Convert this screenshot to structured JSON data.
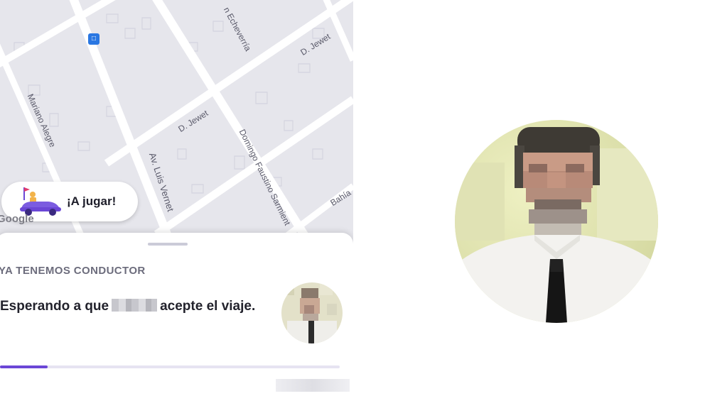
{
  "map": {
    "streets": {
      "echeverria": "n Echeverría",
      "jewet_top": "D. Jewet",
      "jewet_mid": "D. Jewet",
      "mariano_alegre": "Mariano Alegre",
      "luis_vernet": "Av. Luis Vernet",
      "faustino_sarmiento": "Domingo Faustino Sarmient",
      "bahia": "Bahía"
    },
    "google_attribution": "Google",
    "bus_stop_icon": "bus-stop-icon",
    "play_button": {
      "label": "¡A jugar!",
      "icon": "toy-car-icon"
    }
  },
  "trip_sheet": {
    "status": "YA TENEMOS CONDUCTOR",
    "message_before": "Esperando a que",
    "message_after": "acepte el viaje.",
    "progress": 0.14
  },
  "colors": {
    "accent": "#6b47d6",
    "map_background": "#e6e6ec",
    "bus_stop": "#2a77e2"
  }
}
